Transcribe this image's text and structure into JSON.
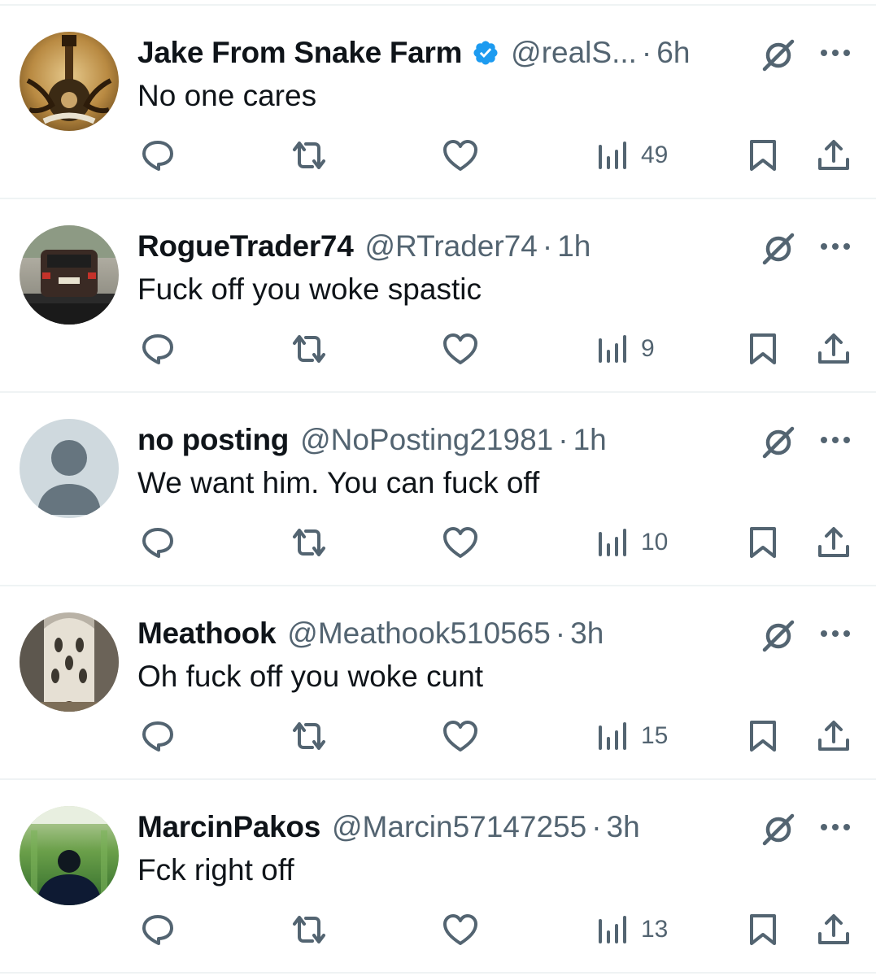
{
  "icons": {
    "reply": "reply-icon",
    "retweet": "retweet-icon",
    "like": "like-icon",
    "views": "views-icon",
    "bookmark": "bookmark-icon",
    "share": "share-icon",
    "grok": "grok-icon",
    "more": "more-icon",
    "verified": "verified-icon"
  },
  "colors": {
    "text_primary": "#0f1419",
    "text_secondary": "#536471",
    "verified_blue": "#1d9bf0",
    "divider": "#eff3f4"
  },
  "tweets": [
    {
      "display_name": "Jake From Snake Farm",
      "verified": true,
      "handle": "@realS...",
      "separator": "·",
      "time": "6h",
      "text": "No one cares",
      "views": "49"
    },
    {
      "display_name": "RogueTrader74",
      "verified": false,
      "handle": "@RTrader74",
      "separator": "·",
      "time": "1h",
      "text": "Fuck off you woke spastic",
      "views": "9"
    },
    {
      "display_name": "no posting",
      "verified": false,
      "handle": "@NoPosting21981",
      "separator": "·",
      "time": "1h",
      "text": "We want him. You can fuck off",
      "views": "10"
    },
    {
      "display_name": "Meathook",
      "verified": false,
      "handle": "@Meathook510565",
      "separator": "·",
      "time": "3h",
      "text": "Oh fuck off you woke cunt",
      "views": "15"
    },
    {
      "display_name": "MarcinPakos",
      "verified": false,
      "handle": "@Marcin57147255",
      "separator": "·",
      "time": "3h",
      "text": "Fck right off",
      "views": "13"
    }
  ]
}
